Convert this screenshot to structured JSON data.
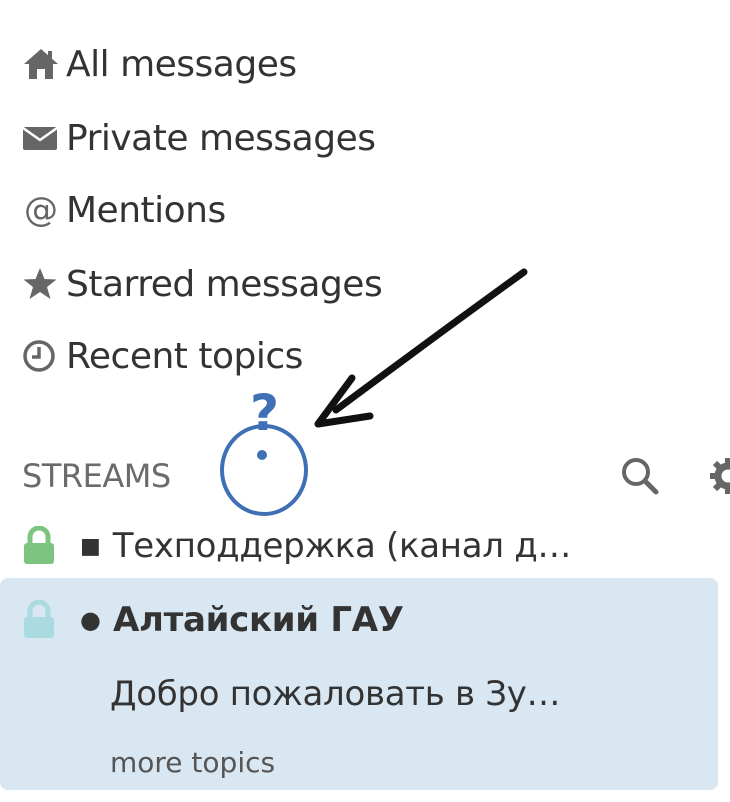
{
  "nav": {
    "items": [
      {
        "label": "All messages",
        "icon": "home-icon"
      },
      {
        "label": "Private messages",
        "icon": "envelope-icon"
      },
      {
        "label": "Mentions",
        "icon": "at-icon",
        "glyph": "@"
      },
      {
        "label": "Starred messages",
        "icon": "star-icon"
      },
      {
        "label": "Recent topics",
        "icon": "clock-icon"
      }
    ]
  },
  "streams": {
    "title": "STREAMS",
    "items": [
      {
        "name": "Техподдержка  (канал д…",
        "marker": "■",
        "lock_color": "#7cc47f"
      },
      {
        "name": "Алтайский ГАУ",
        "marker": "●",
        "lock_color": "#a9dbe0",
        "active": true,
        "topics": [
          {
            "label": "Добро пожаловать в Зу…"
          }
        ],
        "more_topics": "more topics"
      }
    ]
  },
  "annotation": {
    "glyph": "?",
    "color": "#3f6fb5"
  },
  "colors": {
    "active_background": "#d9e7f2",
    "icon_gray": "#666666",
    "text": "#333333"
  }
}
